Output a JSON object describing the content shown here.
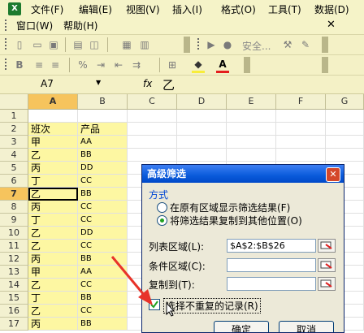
{
  "menu": {
    "row1": [
      "文件(F)",
      "编辑(E)",
      "视图(V)",
      "插入(I)",
      "格式(O)",
      "工具(T)",
      "数据(D)"
    ],
    "row2": [
      "窗口(W)",
      "帮助(H)"
    ],
    "close_glyph": "✕"
  },
  "toolbar1": {
    "security_label": "安全..."
  },
  "formula": {
    "name_box": "A7",
    "fx": "fx",
    "content": "乙"
  },
  "sheet": {
    "columns": [
      "A",
      "B",
      "C",
      "D",
      "E",
      "F",
      "G"
    ],
    "selected_column": "A",
    "selected_row": "7",
    "rows": [
      {
        "n": "1",
        "a": "",
        "b": ""
      },
      {
        "n": "2",
        "a": "班次",
        "b": "产品"
      },
      {
        "n": "3",
        "a": "甲",
        "b": "AA"
      },
      {
        "n": "4",
        "a": "乙",
        "b": "BB"
      },
      {
        "n": "5",
        "a": "丙",
        "b": "DD"
      },
      {
        "n": "6",
        "a": "丁",
        "b": "CC"
      },
      {
        "n": "7",
        "a": "乙",
        "b": "BB"
      },
      {
        "n": "8",
        "a": "丙",
        "b": "CC"
      },
      {
        "n": "9",
        "a": "丁",
        "b": "CC"
      },
      {
        "n": "10",
        "a": "乙",
        "b": "DD"
      },
      {
        "n": "11",
        "a": "乙",
        "b": "CC"
      },
      {
        "n": "12",
        "a": "丙",
        "b": "BB"
      },
      {
        "n": "13",
        "a": "甲",
        "b": "AA"
      },
      {
        "n": "14",
        "a": "乙",
        "b": "CC"
      },
      {
        "n": "15",
        "a": "丁",
        "b": "BB"
      },
      {
        "n": "16",
        "a": "乙",
        "b": "CC"
      },
      {
        "n": "17",
        "a": "丙",
        "b": "BB"
      }
    ]
  },
  "dialog": {
    "title": "高级筛选",
    "close": "✕",
    "mode_label": "方式",
    "option_filter_in_place": "在原有区域显示筛选结果(F)",
    "option_copy_to": "将筛选结果复制到其他位置(O)",
    "list_range_label": "列表区域(L):",
    "list_range_value": "$A$2:$B$26",
    "criteria_range_label": "条件区域(C):",
    "criteria_range_value": "",
    "copy_to_label": "复制到(T):",
    "copy_to_value": "",
    "unique_records_label": "选择不重复的记录(R)",
    "unique_records_checked": true,
    "ok_label": "确定",
    "cancel_label": "取消"
  },
  "colors": {
    "menubar_bg": "#f5f3c8",
    "selection_highlight": "#f6c45d",
    "data_fill": "#fdf7a2",
    "dialog_title": "#0a5bdb",
    "arrow": "#e8332a"
  }
}
